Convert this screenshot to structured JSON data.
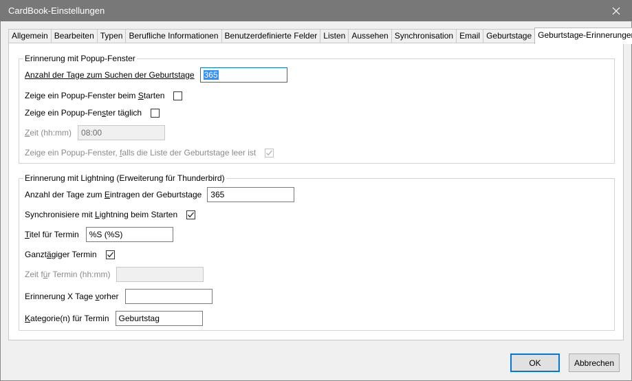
{
  "window": {
    "title": "CardBook-Einstellungen"
  },
  "tabs": [
    {
      "label": "Allgemein"
    },
    {
      "label": "Bearbeiten"
    },
    {
      "label": "Typen"
    },
    {
      "label": "Berufliche Informationen"
    },
    {
      "label": "Benutzerdefinierte Felder"
    },
    {
      "label": "Listen"
    },
    {
      "label": "Aussehen"
    },
    {
      "label": "Synchronisation"
    },
    {
      "label": "Email"
    },
    {
      "label": "Geburtstage"
    },
    {
      "label": "Geburtstage-Erinnerungen",
      "active": true
    }
  ],
  "popup": {
    "legend": "Erinnerung mit Popup-Fenster",
    "days_search": {
      "pre": "Anzahl der Tage zum Suchen der Geburtstage",
      "value": "365"
    },
    "show_on_start": {
      "pre": "Zeige ein Popup-Fenster beim ",
      "key": "S",
      "post": "tarten",
      "checked": false
    },
    "show_daily": {
      "pre": "Zeige ein Popup-Fen",
      "key": "s",
      "post": "ter täglich",
      "checked": false
    },
    "time": {
      "key": "Z",
      "post": "eit (hh:mm)",
      "value": "08:00"
    },
    "show_if_empty": {
      "pre": "Zeige ein Popup-Fenster, ",
      "key": "f",
      "post": "alls die Liste der Geburtstage leer ist",
      "checked": true
    }
  },
  "lightning": {
    "legend": "Erinnerung mit Lightning (Erweiterung für Thunderbird)",
    "days_add": {
      "pre": "Anzahl der Tage zum ",
      "key": "E",
      "post": "intragen der Geburtstage",
      "value": "365"
    },
    "sync_on_start": {
      "pre": "Synchronisiere mit ",
      "key": "L",
      "post": "ightning beim Starten",
      "checked": true
    },
    "event_title": {
      "key": "T",
      "post": "itel für Termin",
      "value": "%S (%S)"
    },
    "all_day": {
      "pre": "Ganzt",
      "key": "ä",
      "post": "giger Termin",
      "checked": true
    },
    "event_time": {
      "pre": "Zeit f",
      "key": "ü",
      "post": "r Termin (hh:mm)",
      "value": ""
    },
    "reminder_days": {
      "pre": "Erinnerung X Tage ",
      "key": "v",
      "post": "orher",
      "value": ""
    },
    "categories": {
      "key": "K",
      "post": "ategorie(n) für Termin",
      "value": "Geburtstag"
    }
  },
  "buttons": {
    "ok": "OK",
    "cancel": "Abbrechen"
  }
}
